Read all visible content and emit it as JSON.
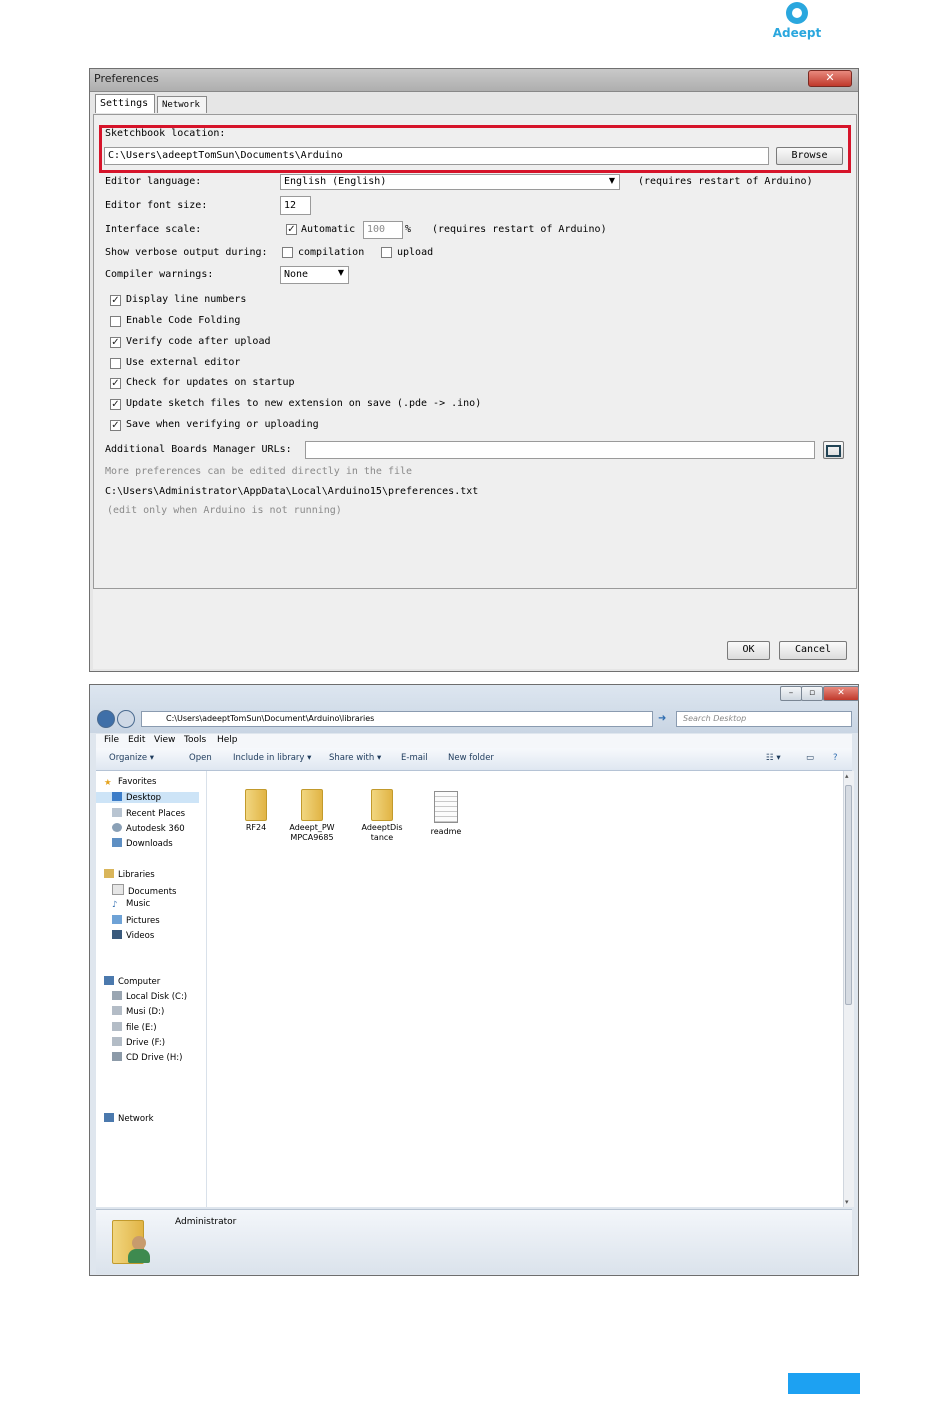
{
  "logo": {
    "text": "Adeept"
  },
  "preferences": {
    "title": "Preferences",
    "close": "✕",
    "tabs": [
      "Settings",
      "Network"
    ],
    "sketchbook_label": "Sketchbook location:",
    "sketchbook_value": "C:\\Users\\adeeptTomSun\\Documents\\Arduino",
    "browse": "Browse",
    "editor_language_label": "Editor language:",
    "editor_language_value": "English (English)",
    "editor_language_note": "(requires restart of Arduino)",
    "font_size_label": "Editor font size:",
    "font_size_value": "12",
    "interface_scale_label": "Interface scale:",
    "automatic": "Automatic",
    "scale_value": "100",
    "percent": "%",
    "scale_note": "(requires restart of Arduino)",
    "verbose_label": "Show verbose output during:",
    "compilation": "compilation",
    "upload": "upload",
    "warnings_label": "Compiler warnings:",
    "warnings_value": "None",
    "options": [
      {
        "label": "Display line numbers",
        "checked": true
      },
      {
        "label": "Enable Code Folding",
        "checked": false
      },
      {
        "label": "Verify code after upload",
        "checked": true
      },
      {
        "label": "Use external editor",
        "checked": false
      },
      {
        "label": "Check for updates on startup",
        "checked": true
      },
      {
        "label": "Update sketch files to new extension on save (.pde -> .ino)",
        "checked": true
      },
      {
        "label": "Save when verifying or uploading",
        "checked": true
      }
    ],
    "boards_label": "Additional Boards Manager URLs:",
    "boards_value": "",
    "more_prefs": "More preferences can be edited directly in the file",
    "prefs_path": "C:\\Users\\Administrator\\AppData\\Local\\Arduino15\\preferences.txt",
    "edit_note": "(edit only when Arduino is not running)",
    "ok": "OK",
    "cancel": "Cancel"
  },
  "explorer": {
    "address": "C:\\Users\\adeeptTomSun\\Document\\Arduino\\libraries",
    "search_placeholder": "Search Desktop",
    "menu": [
      "File",
      "Edit",
      "View",
      "Tools",
      "Help"
    ],
    "commands": [
      "Organize ▾",
      "Open",
      "Include in library ▾",
      "Share with ▾",
      "E-mail",
      "New folder"
    ],
    "nav": {
      "favorites": "Favorites",
      "favorites_items": [
        "Desktop",
        "Recent Places",
        "Autodesk 360",
        "Downloads"
      ],
      "libraries": "Libraries",
      "libraries_items": [
        "Documents",
        "Music",
        "Pictures",
        "Videos"
      ],
      "computer": "Computer",
      "computer_items": [
        "Local Disk (C:)",
        "Musi (D:)",
        "file (E:)",
        "Drive (F:)",
        "CD Drive (H:)"
      ],
      "network": "Network"
    },
    "files": [
      {
        "name": "RF24",
        "type": "folder"
      },
      {
        "name": "Adeept_PWMPCA9685",
        "type": "folder"
      },
      {
        "name": "AdeeptDistance",
        "type": "folder"
      },
      {
        "name": "readme",
        "type": "document"
      }
    ],
    "details_user": "Administrator"
  }
}
